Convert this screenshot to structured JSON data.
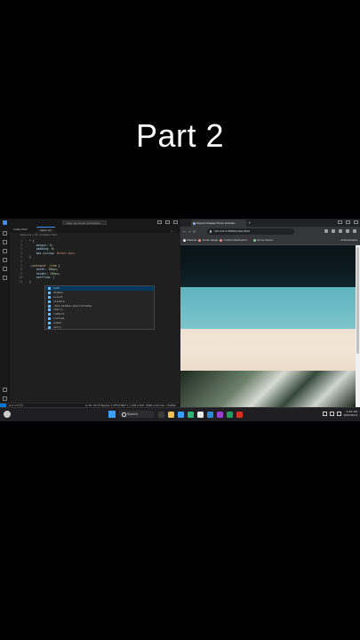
{
  "overlay_title": "Part 2",
  "vscode": {
    "window_title": "copy css hover animation",
    "menu": "··· ",
    "tabs": [
      {
        "label": "index.html"
      },
      {
        "label": "style.css"
      }
    ],
    "breadcrumb": "style.css > 😊 .container item",
    "code_lines": [
      {
        "n": "1",
        "html": "<span class=\"sel\">*</span> {"
      },
      {
        "n": "2",
        "html": "    <span class=\"prop\">margin</span>: <span class=\"num\">0</span>;"
      },
      {
        "n": "3",
        "html": "    <span class=\"prop\">padding</span>: <span class=\"num\">0</span>;"
      },
      {
        "n": "4",
        "html": "    <span class=\"prop\">box-sizing</span>: <span class=\"val\">border-box</span>;"
      },
      {
        "n": "5",
        "html": "}"
      },
      {
        "n": "6",
        "html": ""
      },
      {
        "n": "7",
        "html": "<span class=\"sel\">.container .item</span> {"
      },
      {
        "n": "8",
        "html": "    <span class=\"prop\">width</span>: <span class=\"num\">100px</span>;"
      },
      {
        "n": "9",
        "html": "    <span class=\"prop\">height</span>: <span class=\"num\">100px</span>;"
      },
      {
        "n": "10",
        "html": "    <span class=\"prop\">overflow</span>: |"
      },
      {
        "n": "11",
        "html": "}"
      }
    ],
    "suggestions": [
      "auto",
      "hidden",
      "scroll",
      "visible",
      "-moz-hidden-unscrollable",
      "calc()",
      "inherit",
      "initial",
      "unset",
      "var()"
    ],
    "status_left": "⊗ 0 ⚠ 0   ⓦ 0",
    "status_right": "Ln 10, Col 15   Spaces: 4   UTF-8   CRLF   { } CSS   ⊘ Port : 5500   ⊘ Go Live   ✓ Prettier"
  },
  "browser": {
    "tab_title": "Expand Shapes Hover Animati...",
    "url": "127.0.0.1:5500/index.html",
    "bookmarks": [
      {
        "label": "Material",
        "color": "#e8eaed"
      },
      {
        "label": "Sneak Design",
        "color": "#f28b82"
      },
      {
        "label": "CineOne Studio/and...",
        "color": "#f28b82"
      },
      {
        "label": "Source Social",
        "color": "#81c995"
      }
    ],
    "bookmarks_all": "All Bookmarks"
  },
  "taskbar": {
    "search_label": "Search",
    "time": "2:25 AM",
    "date": "8/25/2024",
    "app_colors": [
      "#3a3a3a",
      "#f2c14e",
      "#3aa0ff",
      "#2bb673",
      "#e8e8e8",
      "#2b8ad6",
      "#9b3fd1",
      "#1e9e5a",
      "#d93025"
    ]
  }
}
